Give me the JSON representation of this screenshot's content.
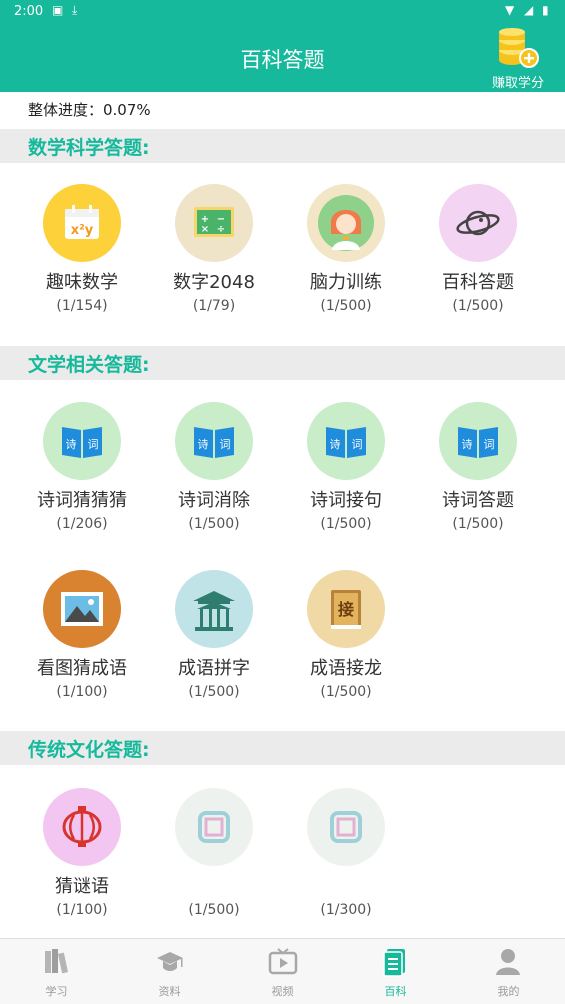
{
  "status_bar": {
    "time": "2:00"
  },
  "header": {
    "title": "百科答题",
    "earn_label": "赚取学分"
  },
  "progress": {
    "label": "整体进度：0.07%"
  },
  "sections": [
    {
      "title": "数学科学答题:",
      "items": [
        {
          "name": "趣味数学",
          "count": "(1/154)"
        },
        {
          "name": "数字2048",
          "count": "(1/79)"
        },
        {
          "name": "脑力训练",
          "count": "(1/500)"
        },
        {
          "name": "百科答题",
          "count": "(1/500)"
        }
      ]
    },
    {
      "title": "文学相关答题:",
      "items": [
        {
          "name": "诗词猜猜猜",
          "count": "(1/206)"
        },
        {
          "name": "诗词消除",
          "count": "(1/500)"
        },
        {
          "name": "诗词接句",
          "count": "(1/500)"
        },
        {
          "name": "诗词答题",
          "count": "(1/500)"
        },
        {
          "name": "看图猜成语",
          "count": "(1/100)"
        },
        {
          "name": "成语拼字",
          "count": "(1/500)"
        },
        {
          "name": "成语接龙",
          "count": "(1/500)"
        }
      ]
    },
    {
      "title": "传统文化答题:",
      "items": [
        {
          "name": "猜谜语",
          "count": "(1/100)"
        },
        {
          "name": "",
          "count": "(1/500)"
        },
        {
          "name": "",
          "count": "(1/300)"
        }
      ]
    }
  ],
  "nav": [
    {
      "label": "学习",
      "icon": "books-icon"
    },
    {
      "label": "资料",
      "icon": "graduation-cap-icon"
    },
    {
      "label": "视频",
      "icon": "tv-play-icon"
    },
    {
      "label": "百科",
      "icon": "document-icon",
      "active": true
    },
    {
      "label": "我的",
      "icon": "person-icon"
    }
  ],
  "colors": {
    "primary": "#16b99b",
    "section_bg": "#ebebeb"
  }
}
